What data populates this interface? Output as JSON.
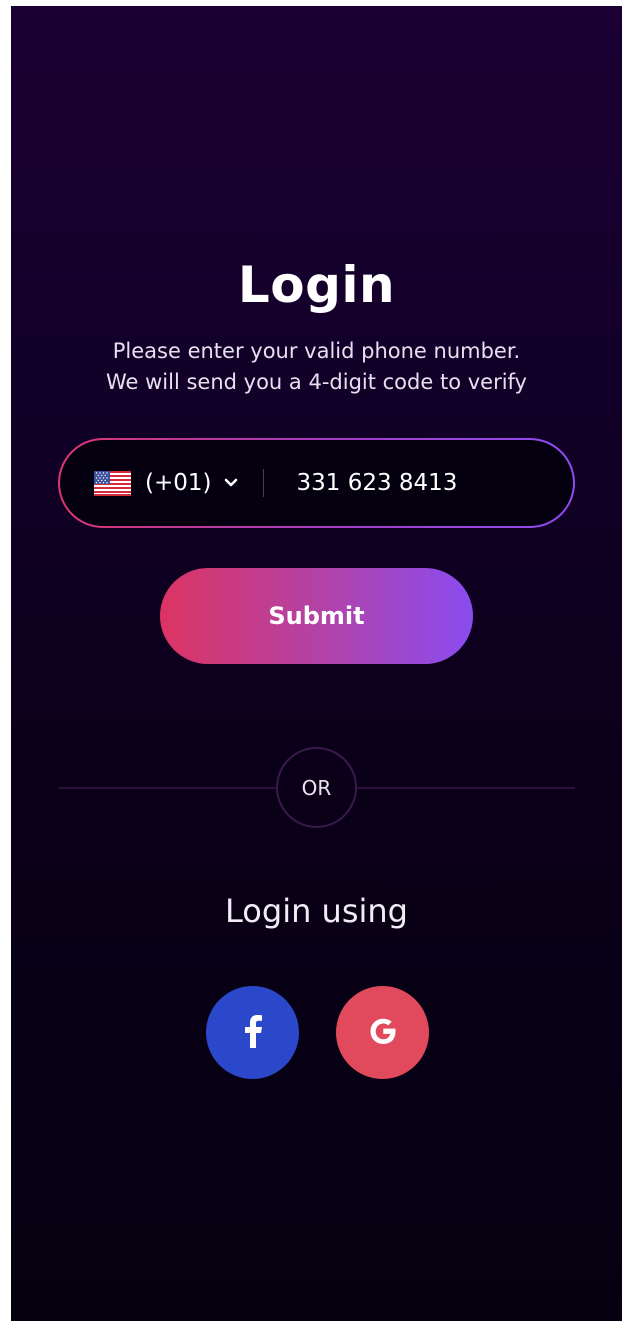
{
  "login": {
    "title": "Login",
    "subtitle_line1": "Please enter your valid phone number.",
    "subtitle_line2": "We will send you a 4-digit code to verify"
  },
  "phone": {
    "country_flag": "us-flag-icon",
    "country_code": "(+01)",
    "number": "331 623 8413"
  },
  "submit": {
    "label": "Submit"
  },
  "divider": {
    "label": "OR"
  },
  "social": {
    "heading": "Login using",
    "providers": [
      {
        "name": "facebook-icon",
        "color": "#2a48c9"
      },
      {
        "name": "google-icon",
        "color": "#e04a5c"
      }
    ]
  },
  "colors": {
    "gradient_start": "#dc3463",
    "gradient_end": "#8a4cf0",
    "background_top": "#1a0033",
    "background_bottom": "#050010"
  }
}
